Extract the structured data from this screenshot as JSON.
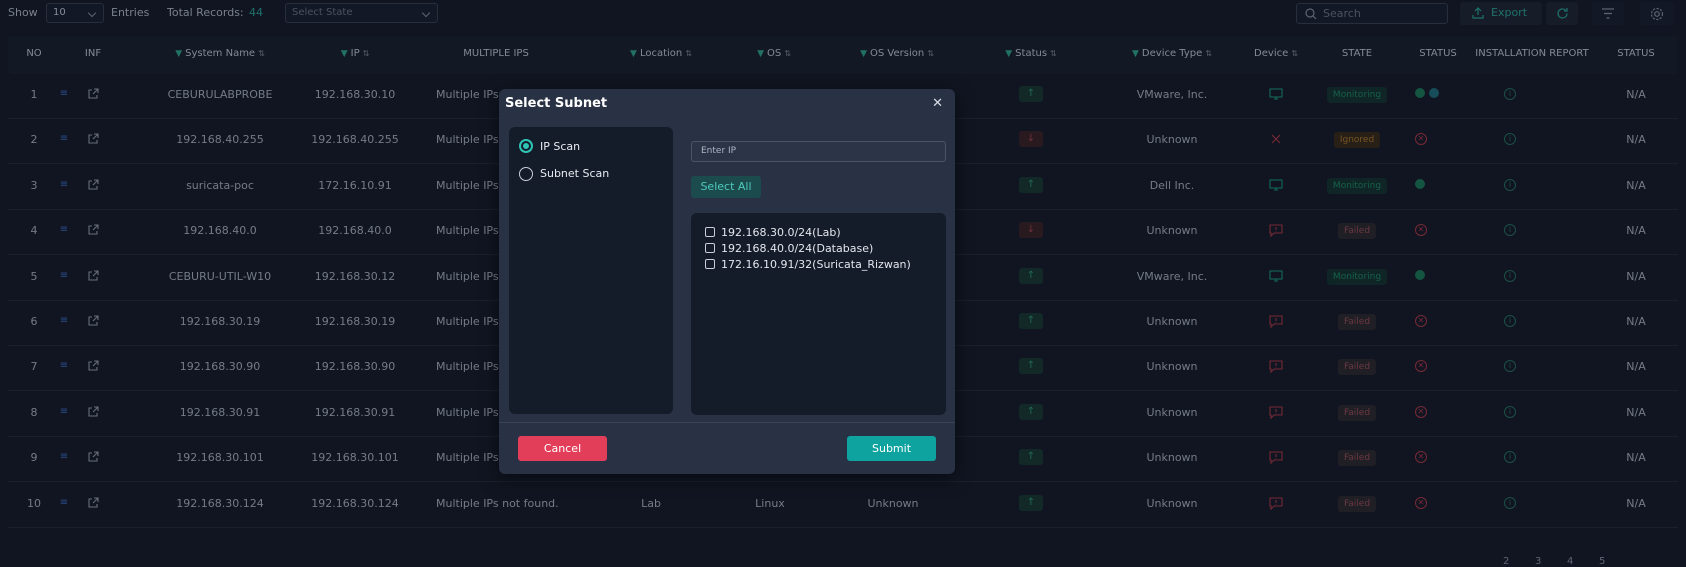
{
  "toolbar": {
    "show_label": "Show",
    "entries_value": "10",
    "entries_label": "Entries",
    "total_label": "Total Records:",
    "total_value": "44",
    "state_placeholder": "Select State",
    "search_placeholder": "Search",
    "export_label": "Export"
  },
  "columns": [
    {
      "label": "NO",
      "filter": false,
      "sort": false
    },
    {
      "label": "INF",
      "filter": false,
      "sort": false
    },
    {
      "label": "System Name",
      "filter": true,
      "sort": true
    },
    {
      "label": "IP",
      "filter": true,
      "sort": true
    },
    {
      "label": "MULTIPLE IPS",
      "filter": false,
      "sort": false
    },
    {
      "label": "Location",
      "filter": true,
      "sort": true
    },
    {
      "label": "OS",
      "filter": true,
      "sort": true
    },
    {
      "label": "OS Version",
      "filter": true,
      "sort": true
    },
    {
      "label": "Status",
      "filter": true,
      "sort": true
    },
    {
      "label": "Device Type",
      "filter": true,
      "sort": true
    },
    {
      "label": "Device",
      "filter": false,
      "sort": true
    },
    {
      "label": "STATE",
      "filter": false,
      "sort": false
    },
    {
      "label": "STATUS",
      "filter": false,
      "sort": false
    },
    {
      "label": "INSTALLATION REPORT",
      "filter": false,
      "sort": false
    },
    {
      "label": "STATUS",
      "filter": false,
      "sort": false
    }
  ],
  "rows": [
    {
      "no": "1",
      "name": "CEBURULABPROBE",
      "ip": "192.168.30.10",
      "multi": "Multiple IPs",
      "location": "",
      "os": "",
      "osver": "",
      "status": "up",
      "device_type": "VMware, Inc.",
      "device": "monitor",
      "state": "Monitoring",
      "dots": 2,
      "install": "info",
      "status2": "N/A"
    },
    {
      "no": "2",
      "name": "192.168.40.255",
      "ip": "192.168.40.255",
      "multi": "Multiple IPs",
      "location": "",
      "os": "",
      "osver": "",
      "status": "down",
      "device_type": "Unknown",
      "device": "cross",
      "state": "Ignored",
      "dots": "x",
      "install": "info",
      "status2": "N/A"
    },
    {
      "no": "3",
      "name": "suricata-poc",
      "ip": "172.16.10.91",
      "multi": "Multiple IPs",
      "location": "",
      "os": "",
      "osver": "",
      "status": "up",
      "device_type": "Dell Inc.",
      "device": "monitor",
      "state": "Monitoring",
      "dots": 1,
      "install": "info",
      "status2": "N/A"
    },
    {
      "no": "4",
      "name": "192.168.40.0",
      "ip": "192.168.40.0",
      "multi": "Multiple IPs",
      "location": "",
      "os": "",
      "osver": "",
      "status": "down",
      "device_type": "Unknown",
      "device": "message",
      "state": "Failed",
      "dots": "x",
      "install": "info",
      "status2": "N/A"
    },
    {
      "no": "5",
      "name": "CEBURU-UTIL-W10",
      "ip": "192.168.30.12",
      "multi": "Multiple IPs",
      "location": "",
      "os": "",
      "osver": "",
      "status": "up",
      "device_type": "VMware, Inc.",
      "device": "monitor",
      "state": "Monitoring",
      "dots": 1,
      "install": "info",
      "status2": "N/A"
    },
    {
      "no": "6",
      "name": "192.168.30.19",
      "ip": "192.168.30.19",
      "multi": "Multiple IPs",
      "location": "",
      "os": "",
      "osver": "",
      "status": "up",
      "device_type": "Unknown",
      "device": "message",
      "state": "Failed",
      "dots": "x",
      "install": "info",
      "status2": "N/A"
    },
    {
      "no": "7",
      "name": "192.168.30.90",
      "ip": "192.168.30.90",
      "multi": "Multiple IPs",
      "location": "",
      "os": "",
      "osver": "",
      "status": "up",
      "device_type": "Unknown",
      "device": "message",
      "state": "Failed",
      "dots": "x",
      "install": "info",
      "status2": "N/A"
    },
    {
      "no": "8",
      "name": "192.168.30.91",
      "ip": "192.168.30.91",
      "multi": "Multiple IPs",
      "location": "",
      "os": "",
      "osver": "",
      "status": "up",
      "device_type": "Unknown",
      "device": "message",
      "state": "Failed",
      "dots": "x",
      "install": "info",
      "status2": "N/A"
    },
    {
      "no": "9",
      "name": "192.168.30.101",
      "ip": "192.168.30.101",
      "multi": "Multiple IPs",
      "location": "",
      "os": "",
      "osver": "",
      "status": "up",
      "device_type": "Unknown",
      "device": "message",
      "state": "Failed",
      "dots": "x",
      "install": "info",
      "status2": "N/A"
    },
    {
      "no": "10",
      "name": "192.168.30.124",
      "ip": "192.168.30.124",
      "multi": "Multiple IPs not found.",
      "location": "Lab",
      "os": "Linux",
      "osver": "Unknown",
      "status": "up",
      "device_type": "Unknown",
      "device": "message",
      "state": "Failed",
      "dots": "x",
      "install": "info",
      "status2": "N/A"
    }
  ],
  "modal": {
    "title": "Select Subnet",
    "ip_scan_label": "IP Scan",
    "subnet_scan_label": "Subnet Scan",
    "ip_placeholder": "Enter IP",
    "select_all_label": "Select All",
    "subnets": [
      "192.168.30.0/24(Lab)",
      "192.168.40.0/24(Database)",
      "172.16.10.91/32(Suricata_Rizwan)"
    ],
    "cancel_label": "Cancel",
    "submit_label": "Submit"
  },
  "pager": {
    "pages": [
      "2",
      "3",
      "4",
      "5"
    ]
  },
  "colors": {
    "accent": "#0fa3a0",
    "danger": "#e23e5a",
    "success": "#1b7d5b"
  }
}
